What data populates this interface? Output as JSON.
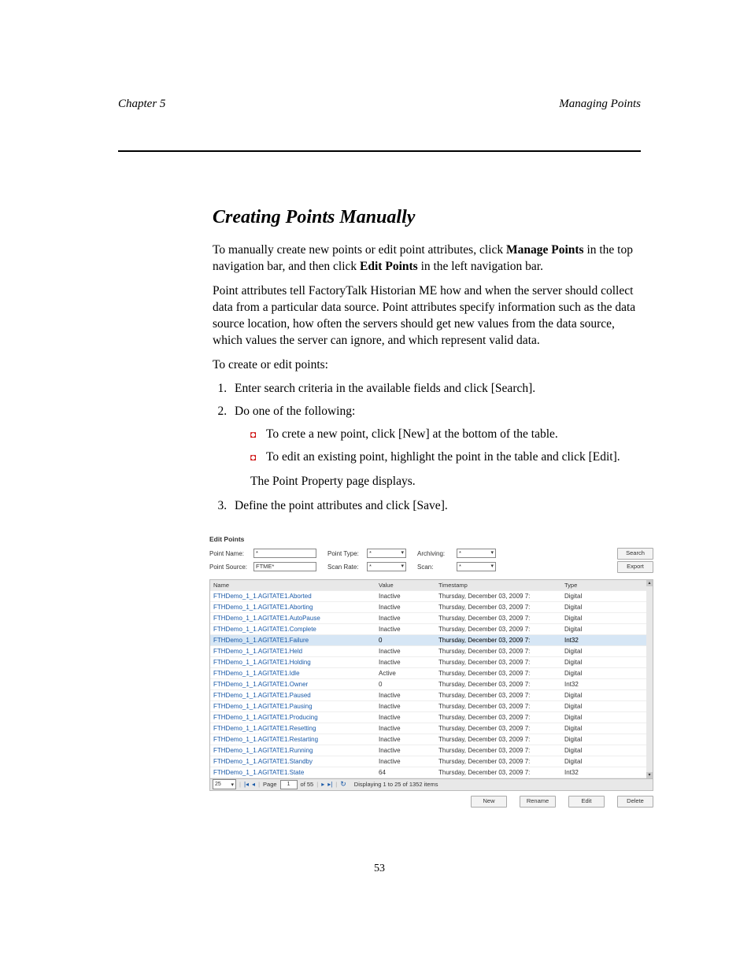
{
  "header": {
    "chapter_left": "Chapter 5",
    "chapter_right": "Managing Points"
  },
  "section_title": "Creating Points Manually",
  "body": {
    "para1_a": "To manually create new points or edit point attributes, click ",
    "para1_b": "Manage Points",
    "para1_c": " in the top navigation bar, and then click ",
    "para1_d": "Edit Points",
    "para1_e": " in the left navigation bar.",
    "para2": "Point attributes tell FactoryTalk Historian ME how and when the server should collect data from a particular data source. Point attributes specify information such as the data source location, how often the servers should get new values from the data source, which values the server can ignore, and which represent valid data.",
    "para3": "To create or edit points:",
    "step1": "Enter search criteria in the available fields and click [Search].",
    "step2": "Do one of the following:",
    "bullet1": "To crete a new point, click [New] at the bottom of the table.",
    "bullet2": "To edit an existing point, highlight the point in the table and click [Edit].",
    "step2_tail": "The Point Property page displays.",
    "step3": "Define the point attributes and click [Save]."
  },
  "app": {
    "title": "Edit Points",
    "labels": {
      "point_name": "Point Name:",
      "point_source": "Point Source:",
      "point_type": "Point Type:",
      "scan_rate": "Scan Rate:",
      "archiving": "Archiving:",
      "scan": "Scan:"
    },
    "filters": {
      "point_name_value": "*",
      "point_source_value": "FTME*",
      "point_type_value": "*",
      "scan_rate_value": "*",
      "archiving_value": "*",
      "scan_value": "*"
    },
    "buttons": {
      "search": "Search",
      "export": "Export",
      "new": "New",
      "rename": "Rename",
      "edit": "Edit",
      "delete": "Delete"
    },
    "columns": {
      "name": "Name",
      "value": "Value",
      "timestamp": "Timestamp",
      "type": "Type"
    },
    "rows": [
      {
        "name": "FTHDemo_1_1.AGITATE1.Aborted",
        "value": "Inactive",
        "ts": "Thursday, December 03, 2009 7:",
        "type": "Digital"
      },
      {
        "name": "FTHDemo_1_1.AGITATE1.Aborting",
        "value": "Inactive",
        "ts": "Thursday, December 03, 2009 7:",
        "type": "Digital"
      },
      {
        "name": "FTHDemo_1_1.AGITATE1.AutoPause",
        "value": "Inactive",
        "ts": "Thursday, December 03, 2009 7:",
        "type": "Digital"
      },
      {
        "name": "FTHDemo_1_1.AGITATE1.Complete",
        "value": "Inactive",
        "ts": "Thursday, December 03, 2009 7:",
        "type": "Digital"
      },
      {
        "name": "FTHDemo_1_1.AGITATE1.Failure",
        "value": "0",
        "ts": "Thursday, December 03, 2009 7:",
        "type": "Int32",
        "selected": true
      },
      {
        "name": "FTHDemo_1_1.AGITATE1.Held",
        "value": "Inactive",
        "ts": "Thursday, December 03, 2009 7:",
        "type": "Digital"
      },
      {
        "name": "FTHDemo_1_1.AGITATE1.Holding",
        "value": "Inactive",
        "ts": "Thursday, December 03, 2009 7:",
        "type": "Digital"
      },
      {
        "name": "FTHDemo_1_1.AGITATE1.Idle",
        "value": "Active",
        "ts": "Thursday, December 03, 2009 7:",
        "type": "Digital"
      },
      {
        "name": "FTHDemo_1_1.AGITATE1.Owner",
        "value": "0",
        "ts": "Thursday, December 03, 2009 7:",
        "type": "Int32"
      },
      {
        "name": "FTHDemo_1_1.AGITATE1.Paused",
        "value": "Inactive",
        "ts": "Thursday, December 03, 2009 7:",
        "type": "Digital"
      },
      {
        "name": "FTHDemo_1_1.AGITATE1.Pausing",
        "value": "Inactive",
        "ts": "Thursday, December 03, 2009 7:",
        "type": "Digital"
      },
      {
        "name": "FTHDemo_1_1.AGITATE1.Producing",
        "value": "Inactive",
        "ts": "Thursday, December 03, 2009 7:",
        "type": "Digital"
      },
      {
        "name": "FTHDemo_1_1.AGITATE1.Resetting",
        "value": "Inactive",
        "ts": "Thursday, December 03, 2009 7:",
        "type": "Digital"
      },
      {
        "name": "FTHDemo_1_1.AGITATE1.Restarting",
        "value": "Inactive",
        "ts": "Thursday, December 03, 2009 7:",
        "type": "Digital"
      },
      {
        "name": "FTHDemo_1_1.AGITATE1.Running",
        "value": "Inactive",
        "ts": "Thursday, December 03, 2009 7:",
        "type": "Digital"
      },
      {
        "name": "FTHDemo_1_1.AGITATE1.Standby",
        "value": "Inactive",
        "ts": "Thursday, December 03, 2009 7:",
        "type": "Digital"
      },
      {
        "name": "FTHDemo_1_1.AGITATE1.State",
        "value": "64",
        "ts": "Thursday, December 03, 2009 7:",
        "type": "Int32"
      }
    ],
    "pager": {
      "page_size": "25",
      "page_label": "Page",
      "page_value": "1",
      "of_label": "of 55",
      "summary": "Displaying 1 to 25 of 1352 items"
    }
  },
  "footer": {
    "page_number": "53"
  }
}
